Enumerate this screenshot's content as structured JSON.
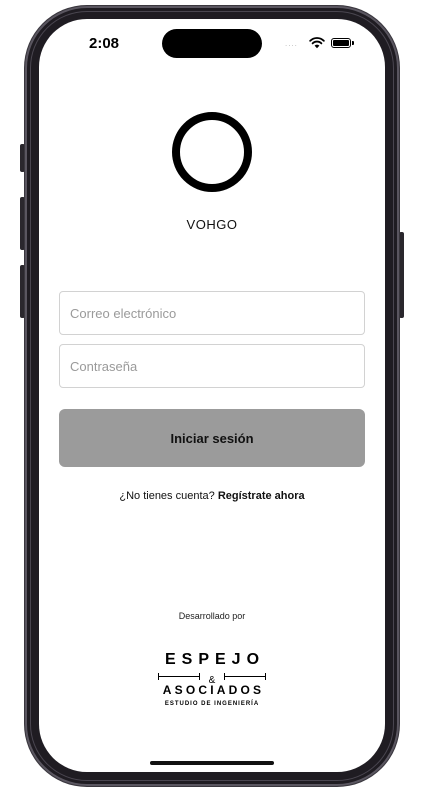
{
  "status_bar": {
    "time": "2:08",
    "signal": "....",
    "wifi_icon": "wifi-icon",
    "battery_icon": "battery-icon"
  },
  "app": {
    "logo_icon": "ring-logo-icon",
    "name": "VOHGO"
  },
  "login_form": {
    "email_placeholder": "Correo electrónico",
    "email_value": "",
    "password_placeholder": "Contraseña",
    "password_value": "",
    "submit_label": "Iniciar sesión",
    "submit_color": "#9b9b9b"
  },
  "register": {
    "prompt": "¿No tienes cuenta?",
    "link_label": "Regístrate ahora"
  },
  "footer": {
    "developed_by": "Desarrollado por",
    "company": {
      "line1": "ESPEJO",
      "ampersand": "&",
      "line2": "ASOCIADOS",
      "tagline": "ESTUDIO DE INGENIERÍA"
    }
  }
}
